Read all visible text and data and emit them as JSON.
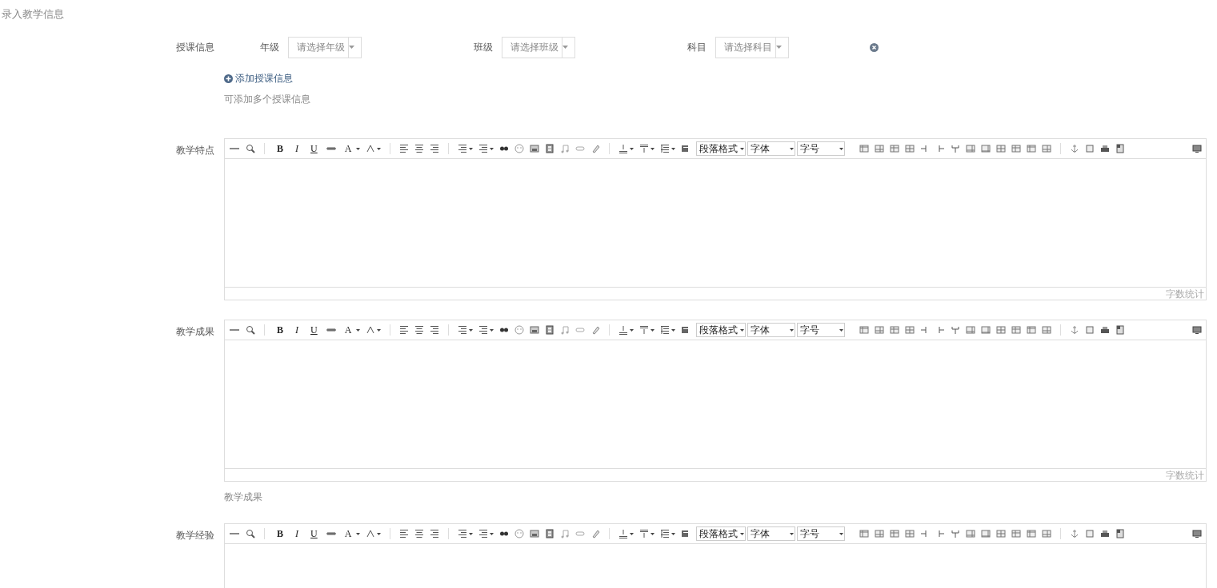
{
  "page_title": "录入教学信息",
  "teaching_info": {
    "label": "授课信息",
    "selects": [
      {
        "label": "年级",
        "placeholder": "请选择年级"
      },
      {
        "label": "班级",
        "placeholder": "请选择班级"
      },
      {
        "label": "科目",
        "placeholder": "请选择科目"
      }
    ],
    "add_link": "添加授课信息",
    "hint": "可添加多个授课信息"
  },
  "editors": [
    {
      "label": "教学特点",
      "toolbar": {
        "bold": "B",
        "italic": "I",
        "underline": "U",
        "font_color": "A",
        "paragraph": "段落格式",
        "font_family": "字体",
        "font_size": "字号"
      },
      "word_count": "字数统计"
    },
    {
      "label": "教学成果",
      "toolbar": {
        "bold": "B",
        "italic": "I",
        "underline": "U",
        "font_color": "A",
        "paragraph": "段落格式",
        "font_family": "字体",
        "font_size": "字号"
      },
      "word_count": "字数统计",
      "hint": "教学成果"
    },
    {
      "label": "教学经验",
      "toolbar": {
        "bold": "B",
        "italic": "I",
        "underline": "U",
        "font_color": "A",
        "paragraph": "段落格式",
        "font_family": "字体",
        "font_size": "字号"
      }
    }
  ]
}
